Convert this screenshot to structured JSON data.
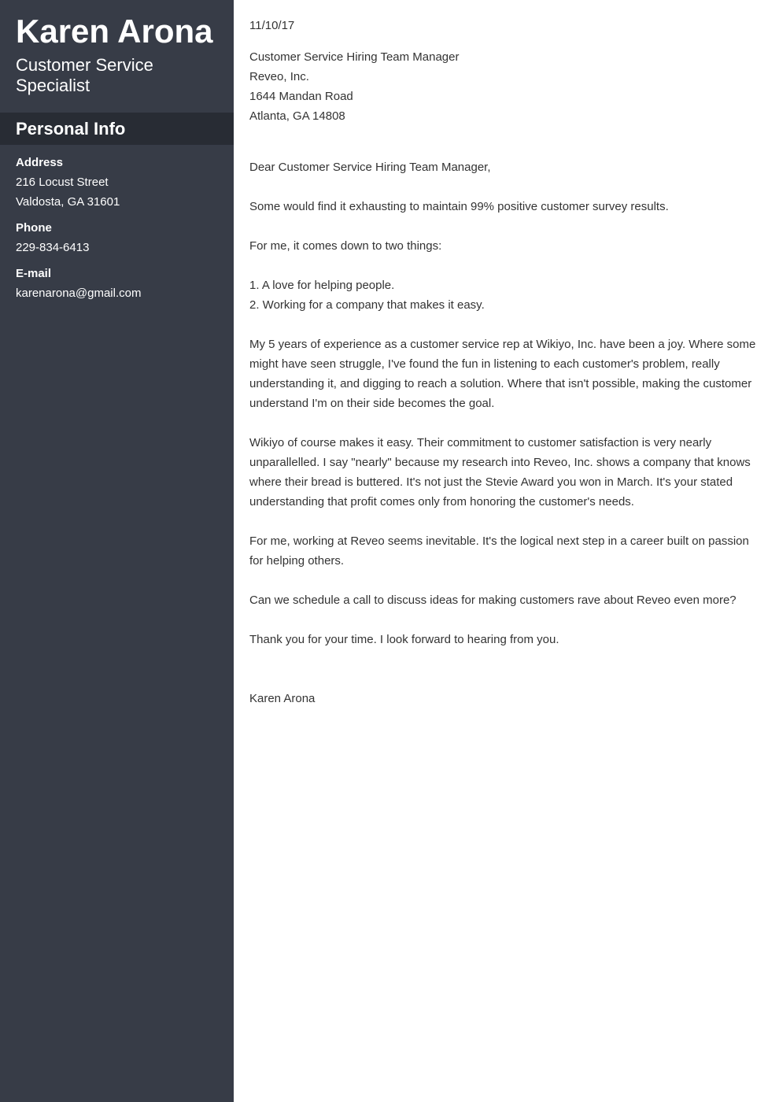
{
  "sidebar": {
    "name": "Karen Arona",
    "title": "Customer Service Specialist",
    "section_title": "Personal Info",
    "address_label": "Address",
    "address_line1": "216 Locust Street",
    "address_line2": "Valdosta, GA 31601",
    "phone_label": "Phone",
    "phone": "229-834-6413",
    "email_label": "E-mail",
    "email": "karenarona@gmail.com"
  },
  "letter": {
    "date": "11/10/17",
    "recipient": [
      "Customer Service Hiring Team Manager",
      "Reveo, Inc.",
      "1644 Mandan Road",
      "Atlanta, GA 14808"
    ],
    "salutation": "Dear Customer Service Hiring Team Manager,",
    "paragraphs": [
      "Some would find it exhausting to maintain 99% positive customer survey results.",
      "For me, it comes down to two things:"
    ],
    "list": [
      "1. A love for helping people.",
      "2. Working for a company that makes it easy."
    ],
    "body": [
      "My 5 years of experience as a customer service rep at Wikiyo, Inc. have been a joy. Where some might have seen struggle, I've found the fun in listening to each customer's problem, really understanding it, and digging to reach a solution. Where that isn't possible, making the customer understand I'm on their side becomes the goal.",
      "Wikiyo of course makes it easy. Their commitment to customer satisfaction is very nearly unparallelled. I say \"nearly\" because my research into Reveo, Inc. shows a company that knows where their bread is buttered. It's not just the Stevie Award you won in March. It's your stated understanding that profit comes only from honoring the customer's needs.",
      "For me, working at Reveo seems inevitable. It's the logical next step in a career built on passion for helping others.",
      "Can we schedule a call to discuss ideas for making customers rave about Reveo even more?"
    ],
    "closing": "Thank you for your time. I look forward to hearing from you.",
    "signature": "Karen Arona"
  },
  "colors": {
    "sidebar_bg": "#373c47",
    "section_band_bg": "#282c34",
    "body_text": "#333333"
  }
}
